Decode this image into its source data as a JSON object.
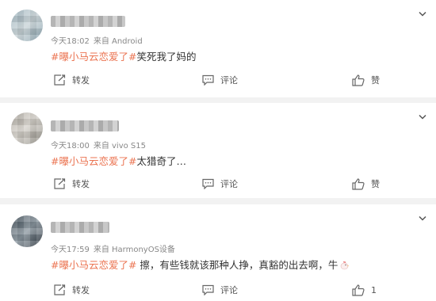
{
  "posts": [
    {
      "time": "今天18:02",
      "source": "来自 Android",
      "hashtag": "#曝小马云恋爱了#",
      "text": "笑死我了妈的",
      "forward_label": "转发",
      "comment_label": "评论",
      "like_label": "赞"
    },
    {
      "time": "今天18:00",
      "source": "来自 vivo S15",
      "hashtag": "#曝小马云恋爱了#",
      "text": "太猎奇了…",
      "forward_label": "转发",
      "comment_label": "评论",
      "like_label": "赞"
    },
    {
      "time": "今天17:59",
      "source": "来自 HarmonyOS设备",
      "hashtag": "#曝小马云恋爱了#",
      "text": " 擦，有些钱就该那种人挣，真豁的出去啊，牛",
      "emoji": "chicken-emoji",
      "forward_label": "转发",
      "comment_label": "评论",
      "like_count": "1"
    }
  ],
  "colors": {
    "hashtag": "#eb7350",
    "meta": "#888888",
    "background": "#f2f2f2"
  },
  "icons": {
    "menu": "chevron-down-icon",
    "forward": "forward-icon",
    "comment": "comment-icon",
    "like": "thumbs-up-icon"
  }
}
